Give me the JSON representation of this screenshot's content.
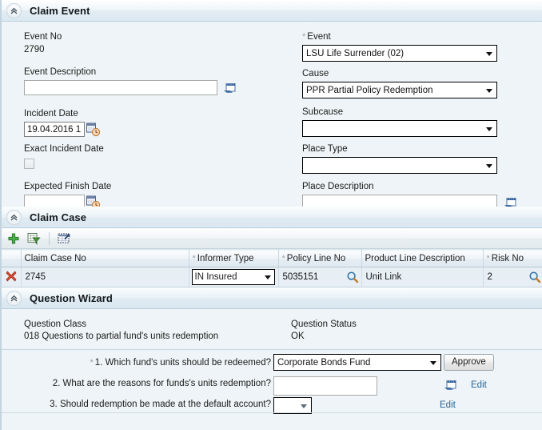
{
  "claim_event": {
    "title": "Claim Event",
    "collapse_icon": "chevron-double-up-icon",
    "event_no_label": "Event No",
    "event_no_value": "2790",
    "event_description_label": "Event Description",
    "event_description_value": "",
    "event_description_note_icon": "notepad-icon",
    "incident_date_label": "Incident Date",
    "incident_date_value": "19.04.2016 1",
    "incident_date_picker_icon": "calendar-clock-icon",
    "exact_incident_date_label": "Exact Incident Date",
    "exact_incident_date_checked": false,
    "expected_finish_date_label": "Expected Finish Date",
    "expected_finish_date_value": "",
    "expected_finish_date_picker_icon": "calendar-clock-icon",
    "event_label": "Event",
    "event_required": "*",
    "event_value": "LSU Life Surrender (02)",
    "cause_label": "Cause",
    "cause_value": "PPR Partial Policy Redemption",
    "subcause_label": "Subcause",
    "subcause_value": "",
    "place_type_label": "Place Type",
    "place_type_value": "",
    "place_description_label": "Place Description",
    "place_description_value": "",
    "place_description_note_icon": "notepad-icon"
  },
  "claim_case": {
    "title": "Claim Case",
    "collapse_icon": "chevron-double-up-icon",
    "toolbar": [
      {
        "name": "add-row-button",
        "icon": "green-plus-icon",
        "label": "Add"
      },
      {
        "name": "filter-button",
        "icon": "table-filter-icon",
        "label": "Filter"
      },
      {
        "name": "export-button",
        "icon": "export-grid-icon",
        "label": "Export"
      }
    ],
    "columns": [
      {
        "label": "",
        "required": ""
      },
      {
        "label": "Claim Case No",
        "required": ""
      },
      {
        "label": "Informer Type",
        "required": "*"
      },
      {
        "label": "Policy Line No",
        "required": "*"
      },
      {
        "label": "Product Line Description",
        "required": ""
      },
      {
        "label": "Risk No",
        "required": "*"
      }
    ],
    "rows": [
      {
        "delete_icon": "red-x-delete-icon",
        "claim_case_no": "2745",
        "informer_type": "IN Insured",
        "policy_line_no": "5035151",
        "policy_line_search_icon": "magnifier-icon",
        "product_line_description": "Unit Link",
        "risk_no": "2",
        "risk_search_icon": "magnifier-icon"
      }
    ]
  },
  "question_wizard": {
    "title": "Question Wizard",
    "collapse_icon": "chevron-double-up-icon",
    "question_class_label": "Question Class",
    "question_class_value": "018 Questions to partial fund's units redemption",
    "question_status_label": "Question Status",
    "question_status_value": "OK",
    "questions": [
      {
        "required": "*",
        "text": "1. Which fund's units should be redeemed?",
        "control": "select",
        "value": "Corporate Bonds Fund",
        "action_label": "Approve",
        "action_type": "button"
      },
      {
        "required": "",
        "text": "2. What are the reasons for funds's units redemption?",
        "control": "text",
        "value": "",
        "note_icon": "notepad-icon",
        "action_label": "Edit",
        "action_type": "link"
      },
      {
        "required": "",
        "text": "3. Should redemption be made at the default account?",
        "control": "select-small",
        "value": "",
        "action_label": "Edit",
        "action_type": "link"
      }
    ]
  },
  "colors": {
    "panel_bg": "#eef4f7",
    "header_bar": "#e2edf3",
    "grid_row": "#e7eff5",
    "link": "#2a6496",
    "required_star": "#9aa3a9",
    "delete_x": "#cc3b28",
    "add_plus": "#3e9e3e"
  }
}
